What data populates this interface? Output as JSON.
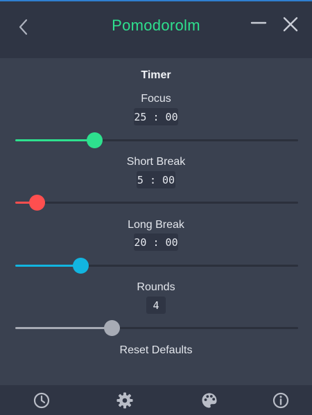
{
  "app": {
    "title": "Pomodorolm",
    "accent_color": "#2ee08e",
    "icons": {
      "back": "chevron-left-icon",
      "minimize": "minimize-icon",
      "close": "close-icon"
    }
  },
  "settings": {
    "heading": "Timer",
    "focus": {
      "label": "Focus",
      "value": "25 : 00",
      "slider_fraction": 0.28,
      "color": "#2ee08e"
    },
    "short_break": {
      "label": "Short Break",
      "value": "5 : 00",
      "slider_fraction": 0.075,
      "color": "#ff4f4f"
    },
    "long_break": {
      "label": "Long Break",
      "value": "20 : 00",
      "slider_fraction": 0.23,
      "color": "#12b5e0"
    },
    "rounds": {
      "label": "Rounds",
      "value": "4",
      "slider_fraction": 0.34,
      "color": "#a7abb5"
    },
    "reset_label": "Reset Defaults"
  },
  "nav": {
    "icons": [
      "clock-icon",
      "gear-icon",
      "palette-icon",
      "info-icon"
    ]
  }
}
